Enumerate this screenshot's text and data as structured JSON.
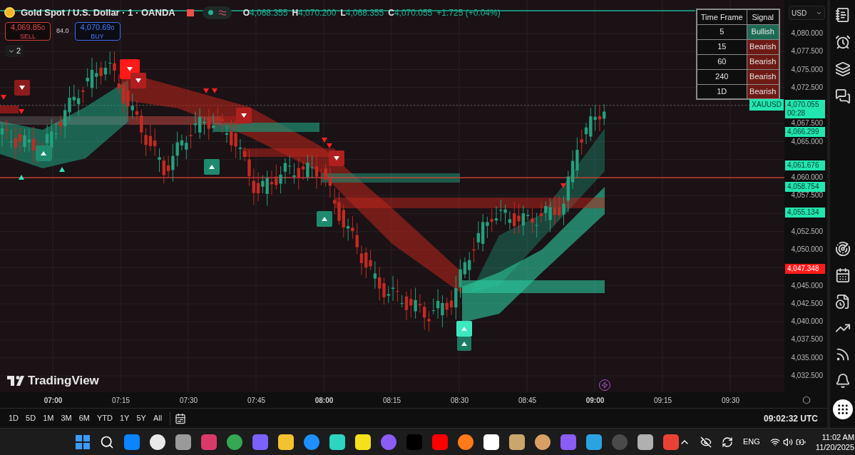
{
  "header": {
    "symbol": "Gold Spot / U.S. Dollar · 1 · OANDA",
    "ohlc": [
      {
        "key": "O",
        "value": "4,068.355"
      },
      {
        "key": "H",
        "value": "4,070.200"
      },
      {
        "key": "L",
        "value": "4,068.355"
      },
      {
        "key": "C",
        "value": "4,070.055"
      }
    ],
    "change": "+1.725 (+0.04%)"
  },
  "trade": {
    "sell": {
      "price": "4,069.85",
      "tail": "0",
      "label": "SELL"
    },
    "spread": "84.0",
    "buy": {
      "price": "4,070.69",
      "tail": "0",
      "label": "BUY"
    }
  },
  "indicators_toggle": {
    "count": "2"
  },
  "signal_table": {
    "columns": [
      "Time Frame",
      "Signal"
    ],
    "rows": [
      {
        "timeframe": "5",
        "signal": "Bullish",
        "color": "#1d6b55"
      },
      {
        "timeframe": "15",
        "signal": "Bearish",
        "color": "#6e1a14"
      },
      {
        "timeframe": "60",
        "signal": "Bearish",
        "color": "#6e1a14"
      },
      {
        "timeframe": "240",
        "signal": "Bearish",
        "color": "#6e1a14"
      },
      {
        "timeframe": "1D",
        "signal": "Bearish",
        "color": "#6e1a14"
      }
    ]
  },
  "currency": "USD",
  "symbol_tag": "XAUUSD",
  "price_ticks": [
    "4,080.000",
    "4,077.500",
    "4,075.000",
    "4,072.500",
    "4,067.500",
    "4,065.000",
    "4,060.000",
    "4,057.500",
    "4,052.500",
    "4,050.000",
    "4,045.000",
    "4,042.500",
    "4,040.000",
    "4,037.500",
    "4,035.000",
    "4,032.500"
  ],
  "price_badges": [
    {
      "price": "4,070.055",
      "countdown": "00:28",
      "kind": "bull"
    },
    {
      "price": "4,066.299",
      "kind": "bull"
    },
    {
      "price": "4,061.676",
      "kind": "bull"
    },
    {
      "price": "4,058.754",
      "kind": "bull"
    },
    {
      "price": "4,055.134",
      "kind": "bull"
    },
    {
      "price": "4,047.348",
      "kind": "bear"
    }
  ],
  "logo": "TradingView",
  "time_axis": [
    {
      "label": "07:00",
      "bold": true
    },
    {
      "label": "07:15",
      "bold": false
    },
    {
      "label": "07:30",
      "bold": false
    },
    {
      "label": "07:45",
      "bold": false
    },
    {
      "label": "08:00",
      "bold": true
    },
    {
      "label": "08:15",
      "bold": false
    },
    {
      "label": "08:30",
      "bold": false
    },
    {
      "label": "08:45",
      "bold": false
    },
    {
      "label": "09:00",
      "bold": true
    },
    {
      "label": "09:15",
      "bold": false
    },
    {
      "label": "09:30",
      "bold": false
    }
  ],
  "ranges": [
    "1D",
    "5D",
    "1M",
    "3M",
    "6M",
    "YTD",
    "1Y",
    "5Y",
    "All"
  ],
  "clock": "09:02:32 UTC",
  "taskbar": {
    "language": "ENG",
    "time": "11:02 AM",
    "date": "11/20/2025"
  }
}
